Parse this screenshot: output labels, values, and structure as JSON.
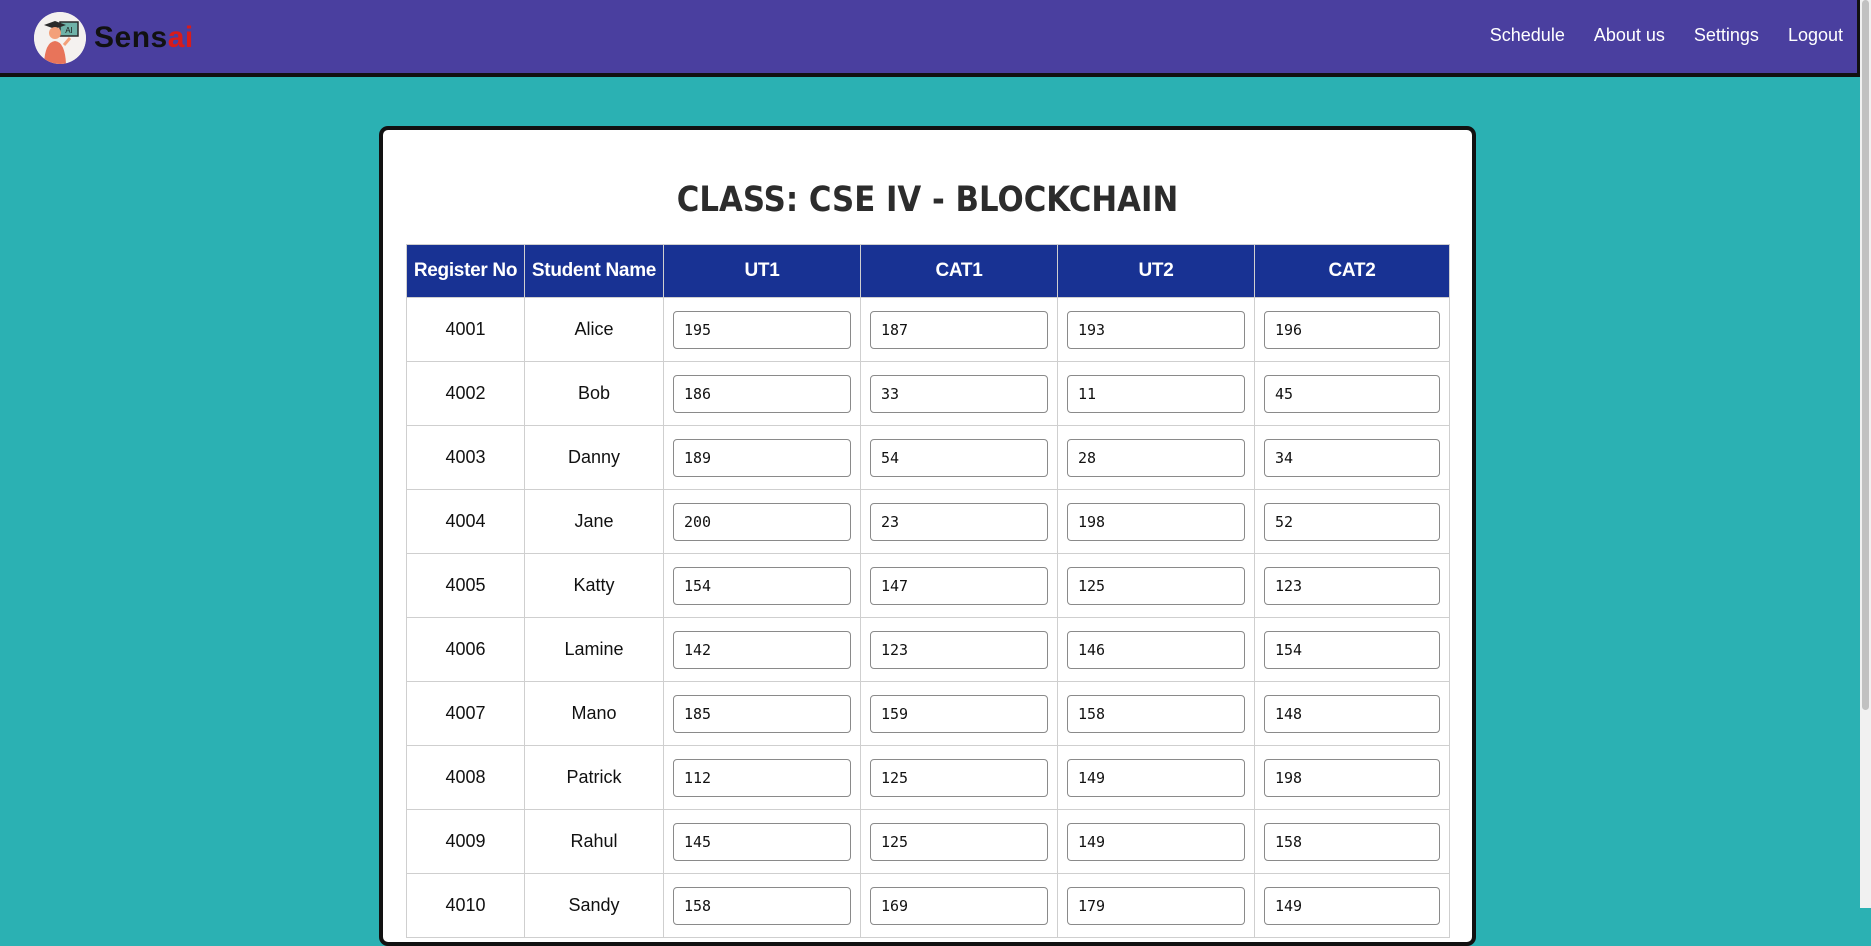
{
  "app": {
    "brand_main": "Sens",
    "brand_accent": "ai",
    "logo_badge": "AI",
    "accent_color": "#4a3f9f",
    "background_color": "#2bb1b3",
    "header_color": "#183293"
  },
  "nav": {
    "links": [
      "Schedule",
      "About us",
      "Settings",
      "Logout"
    ]
  },
  "page": {
    "title": "CLASS: CSE IV - BLOCKCHAIN"
  },
  "table": {
    "headers": [
      "Register No",
      "Student Name",
      "UT1",
      "CAT1",
      "UT2",
      "CAT2"
    ],
    "rows": [
      {
        "reg": "4001",
        "name": "Alice",
        "marks": [
          "195",
          "187",
          "193",
          "196"
        ]
      },
      {
        "reg": "4002",
        "name": "Bob",
        "marks": [
          "186",
          "33",
          "11",
          "45"
        ]
      },
      {
        "reg": "4003",
        "name": "Danny",
        "marks": [
          "189",
          "54",
          "28",
          "34"
        ]
      },
      {
        "reg": "4004",
        "name": "Jane",
        "marks": [
          "200",
          "23",
          "198",
          "52"
        ]
      },
      {
        "reg": "4005",
        "name": "Katty",
        "marks": [
          "154",
          "147",
          "125",
          "123"
        ]
      },
      {
        "reg": "4006",
        "name": "Lamine",
        "marks": [
          "142",
          "123",
          "146",
          "154"
        ]
      },
      {
        "reg": "4007",
        "name": "Mano",
        "marks": [
          "185",
          "159",
          "158",
          "148"
        ]
      },
      {
        "reg": "4008",
        "name": "Patrick",
        "marks": [
          "112",
          "125",
          "149",
          "198"
        ]
      },
      {
        "reg": "4009",
        "name": "Rahul",
        "marks": [
          "145",
          "125",
          "149",
          "158"
        ]
      },
      {
        "reg": "4010",
        "name": "Sandy",
        "marks": [
          "158",
          "169",
          "179",
          "149"
        ]
      }
    ]
  }
}
